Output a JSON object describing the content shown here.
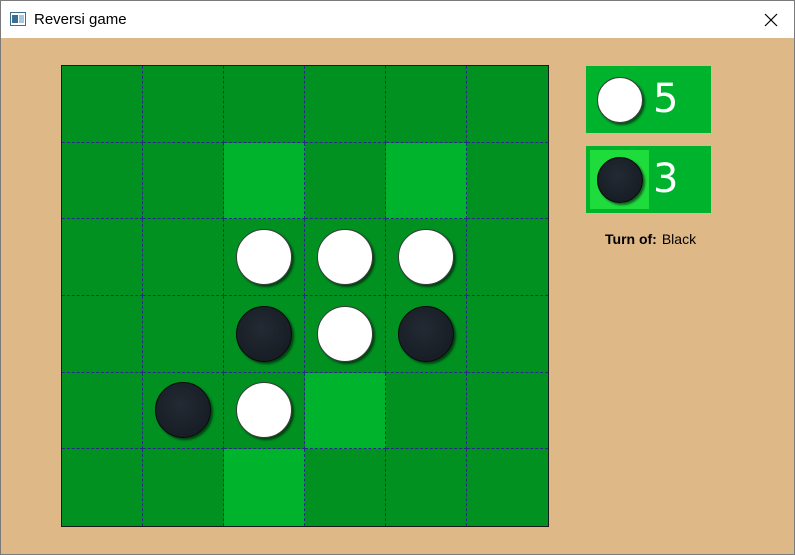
{
  "window": {
    "title": "Reversi game"
  },
  "colors": {
    "background": "#deb887",
    "board": "#009121",
    "valid_move": "#00b32c",
    "grid_line": "#2a2a8a",
    "score_panel": "#00b32c",
    "active_player_highlight": "#1fdc3d"
  },
  "board": {
    "rows": 6,
    "cols": 6,
    "cells": [
      [
        "",
        "",
        "",
        "",
        "",
        ""
      ],
      [
        "",
        "",
        "valid",
        "",
        "valid",
        ""
      ],
      [
        "",
        "",
        "white",
        "white",
        "white",
        ""
      ],
      [
        "",
        "",
        "black",
        "white",
        "black",
        ""
      ],
      [
        "",
        "black",
        "white",
        "valid",
        "",
        ""
      ],
      [
        "",
        "",
        "valid",
        "",
        "",
        ""
      ]
    ]
  },
  "scores": {
    "white": "5",
    "black": "3"
  },
  "turn": {
    "label": "Turn of:",
    "value": "Black"
  }
}
